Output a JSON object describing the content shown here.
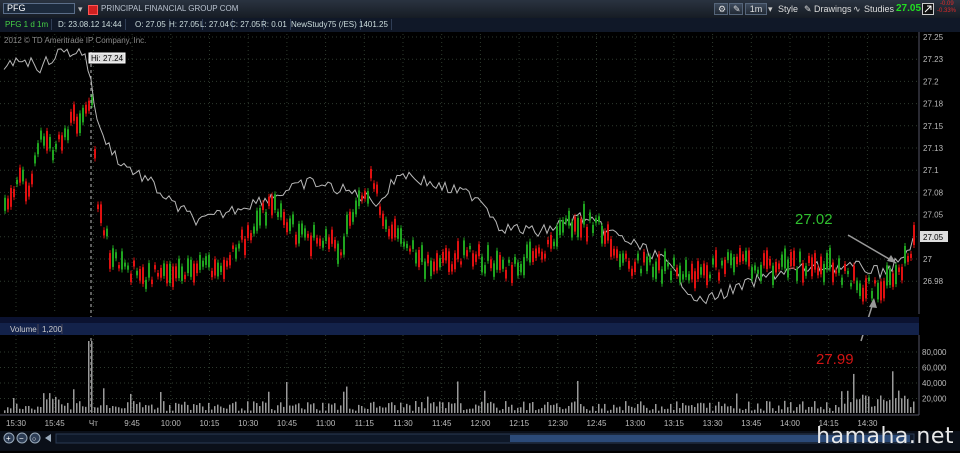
{
  "toolbar": {
    "symbol": "PFG",
    "company_name": "PRINCIPAL FINANCIAL GROUP COM",
    "interval": "1m",
    "style_label": "Style",
    "drawings_label": "Drawings",
    "studies_label": "Studies",
    "last_price": "27.05",
    "change_top": "-0.09",
    "change_bottom": "-0.33%"
  },
  "infobar": {
    "series": "PFG 1 d 1m",
    "date": "D: 23.08.12 14:44",
    "open": "O: 27.05",
    "high": "H: 27.05",
    "low": "L: 27.04",
    "close": "C: 27.05",
    "range": "R: 0.01",
    "study": "NewStudy75 (/ES)",
    "study_value": "1401.25"
  },
  "price_panel": {
    "copyright": "2012 © TD Ameritrade IP Company, Inc.",
    "high_marker": "Hi: 27.24",
    "current_marker": "27.05",
    "y_ticks": [
      "27.25",
      "27.23",
      "27.2",
      "27.18",
      "27.15",
      "27.13",
      "27.1",
      "27.08",
      "27.05",
      "27.03",
      "27",
      "26.98"
    ],
    "annotation_green": "27.02",
    "annotation_red": "27.99",
    "colors": {
      "up": "#1fa51f",
      "down": "#e01010",
      "compare": "#b8b8b8",
      "green_text": "#2fbf2f",
      "red_text": "#d21414"
    }
  },
  "volume_panel": {
    "label": "Volume",
    "value": "1,200",
    "y_ticks": [
      "80,000",
      "60,000",
      "40,000",
      "20,000"
    ]
  },
  "x_axis": {
    "ticks": [
      "15:30",
      "15:45",
      "Чт",
      "9:45",
      "10:00",
      "10:15",
      "10:30",
      "10:45",
      "11:00",
      "11:15",
      "11:30",
      "11:45",
      "12:00",
      "12:15",
      "12:30",
      "12:45",
      "13:00",
      "13:15",
      "13:30",
      "13:45",
      "14:00",
      "14:15",
      "14:30"
    ]
  },
  "watermark": "hamaha.net"
}
